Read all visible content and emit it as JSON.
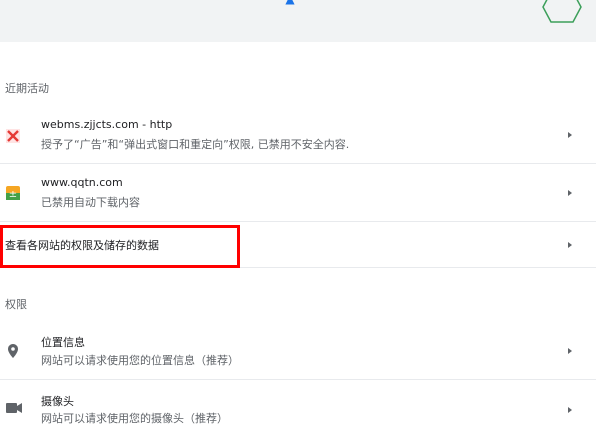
{
  "colors": {
    "accent": "#1a73e8",
    "highlight": "#ff0000",
    "muted_text": "#5f6368"
  },
  "recent_activity": {
    "header": "近期活动",
    "items": [
      {
        "icon": "blocked-site-icon",
        "title": "webms.zjjcts.com - http",
        "subtitle": "授予了“广告”和“弹出式窗口和重定向”权限, 已禁用不安全内容."
      },
      {
        "icon": "site-favicon",
        "title": "www.qqtn.com",
        "subtitle": "已禁用自动下载内容"
      }
    ],
    "view_all": "查看各网站的权限及储存的数据"
  },
  "permissions": {
    "header": "权限",
    "items": [
      {
        "icon": "location-icon",
        "title": "位置信息",
        "subtitle": "网站可以请求使用您的位置信息（推荐）"
      },
      {
        "icon": "camera-icon",
        "title": "摄像头",
        "subtitle": "网站可以请求使用您的摄像头（推荐）"
      }
    ]
  }
}
